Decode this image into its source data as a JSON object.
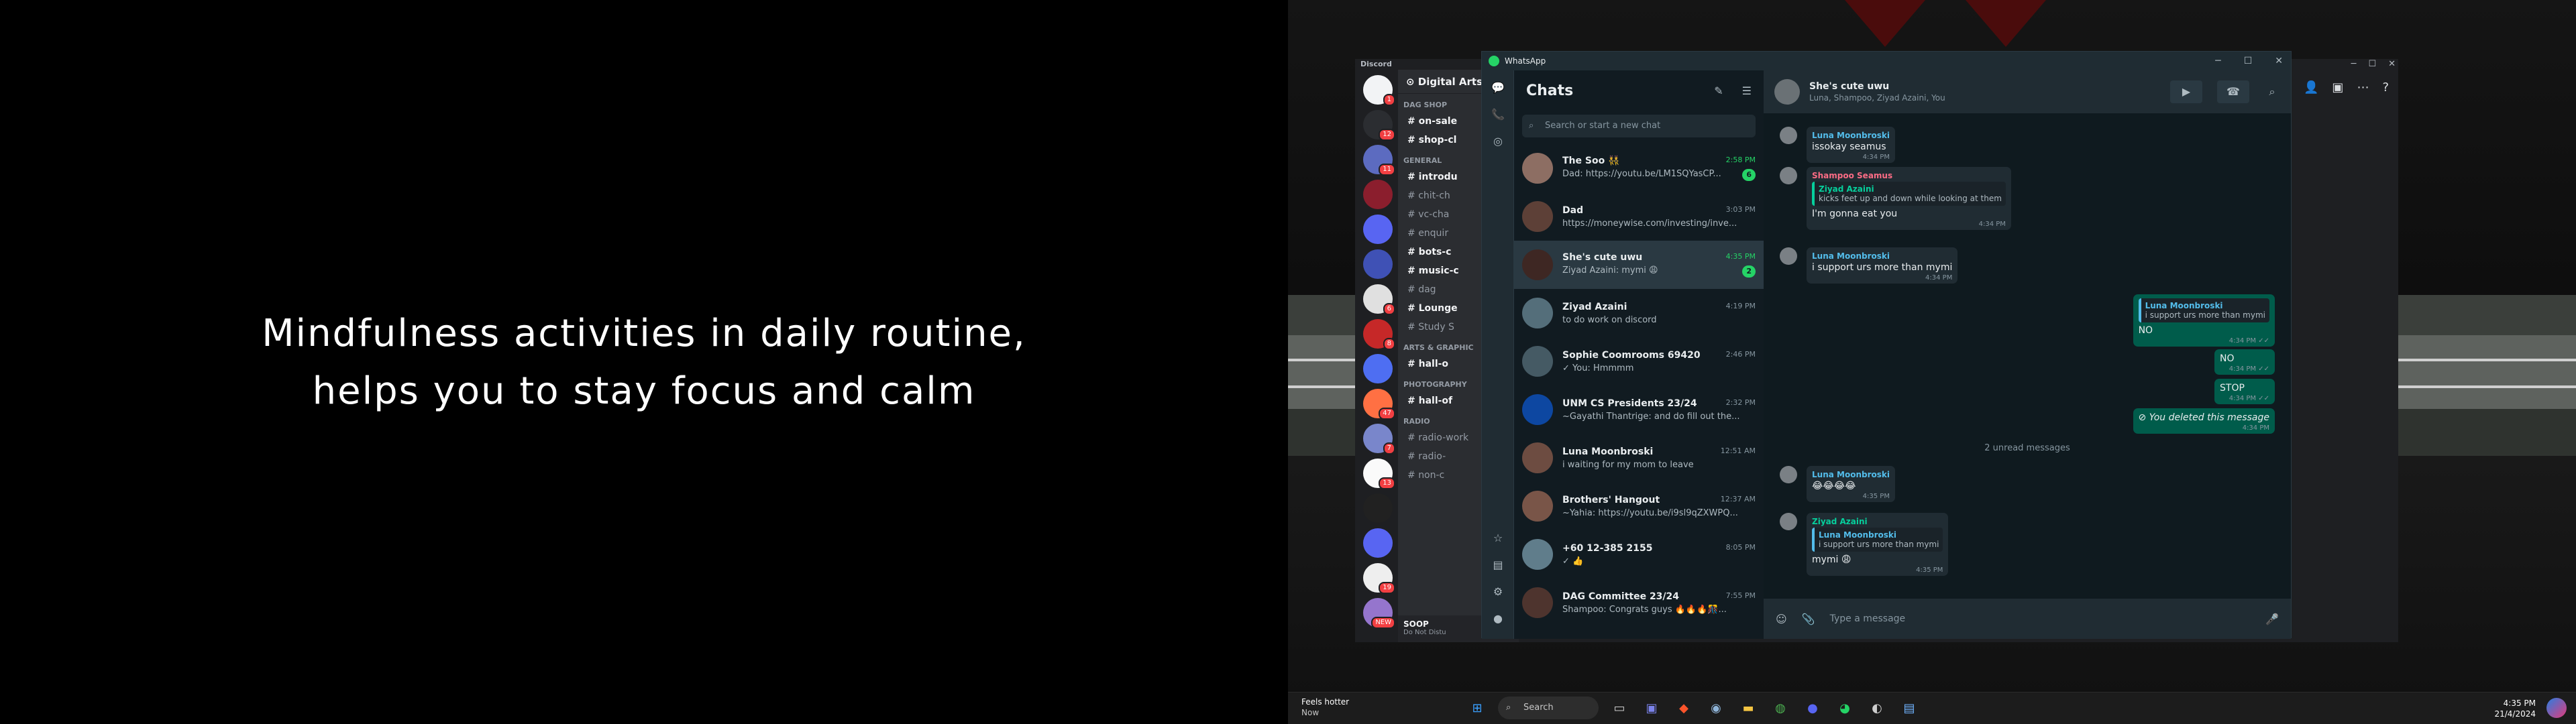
{
  "quote": {
    "line1": "Mindfulness activities in daily routine,",
    "line2": "helps you to stay focus and calm"
  },
  "discord": {
    "app_name": "Discord",
    "guild_name": "Digital Arts",
    "server_badges": [
      "1",
      "12",
      "11",
      "",
      "",
      "",
      "6",
      "8",
      "",
      "47",
      "7",
      "13",
      "",
      "",
      "19",
      "NEW"
    ],
    "categories": [
      {
        "name": "DAG SHOP",
        "channels": [
          {
            "name": "on-sale",
            "unread": true
          },
          {
            "name": "shop-cl",
            "unread": true
          }
        ]
      },
      {
        "name": "GENERAL",
        "channels": [
          {
            "name": "introdu",
            "unread": true
          },
          {
            "name": "chit-ch",
            "unread": false
          },
          {
            "name": "vc-cha",
            "unread": false
          },
          {
            "name": "enquir",
            "unread": false
          },
          {
            "name": "bots-c",
            "unread": true
          },
          {
            "name": "music-c",
            "unread": true
          },
          {
            "name": "dag",
            "unread": false
          },
          {
            "name": "Lounge",
            "unread": true
          },
          {
            "name": "Study S",
            "unread": false
          }
        ]
      },
      {
        "name": "ARTS & GRAPHIC",
        "channels": [
          {
            "name": "hall-o",
            "unread": true
          }
        ]
      },
      {
        "name": "PHOTOGRAPHY",
        "channels": [
          {
            "name": "hall-of",
            "unread": true
          }
        ]
      },
      {
        "name": "RADIO",
        "channels": [
          {
            "name": "radio-work",
            "unread": false
          },
          {
            "name": "radio-",
            "unread": false
          },
          {
            "name": "non-c",
            "unread": false
          }
        ]
      }
    ],
    "user": {
      "name": "SOOP",
      "status": "Do Not Distu"
    }
  },
  "whatsapp": {
    "title": "WhatsApp",
    "chats_title": "Chats",
    "search_placeholder": "Search or start a new chat",
    "chats": [
      {
        "name": "The Soo 👯",
        "time": "2:58 PM",
        "preview": "Dad: https://youtu.be/LM1SQYasCP...",
        "unread": "6",
        "time_green": true
      },
      {
        "name": "Dad",
        "time": "3:03 PM",
        "preview": "https://moneywise.com/investing/inve...",
        "unread": "",
        "time_green": false
      },
      {
        "name": "She's cute uwu",
        "time": "4:35 PM",
        "preview": "Ziyad Azaini: mymi 😩",
        "unread": "2",
        "time_green": true
      },
      {
        "name": "Ziyad Azaini",
        "time": "4:19 PM",
        "preview": "to do work on discord",
        "unread": "",
        "time_green": false
      },
      {
        "name": "Sophie Coomrooms 69420",
        "time": "2:46 PM",
        "preview": "✓ You: Hmmmm",
        "unread": "",
        "time_green": false
      },
      {
        "name": "UNM CS Presidents 23/24",
        "time": "2:32 PM",
        "preview": "~Gayathi Thantrige: and do fill out the...",
        "unread": "",
        "time_green": false
      },
      {
        "name": "Luna Moonbroski",
        "time": "12:51 AM",
        "preview": "i waiting for my mom to leave",
        "unread": "",
        "time_green": false
      },
      {
        "name": "Brothers' Hangout",
        "time": "12:37 AM",
        "preview": "~Yahia: https://youtu.be/i9sl9qZXWPQ...",
        "unread": "",
        "time_green": false
      },
      {
        "name": "+60 12-385 2155",
        "time": "8:05 PM",
        "preview": "✓ 👍",
        "unread": "",
        "time_green": false
      },
      {
        "name": "DAG Committee 23/24",
        "time": "7:55 PM",
        "preview": "Shampoo: Congrats guys 🔥🔥🔥🎊...",
        "unread": "",
        "time_green": false
      }
    ],
    "conversation": {
      "name": "She's cute uwu",
      "members": "Luna, Shampoo, Ziyad Azaini, You",
      "messages": [
        {
          "author": "Luna Moonbroski",
          "text": "issokay seamus",
          "time": "4:34 PM"
        },
        {
          "author": "Shampoo Seamus",
          "quote_author": "Ziyad Azaini",
          "quote_text": "kicks feet up and down while looking at them",
          "text": "I'm gonna eat you",
          "time": "4:34 PM"
        },
        {
          "author": "Luna Moonbroski",
          "text": "i support urs more than mymi",
          "time": "4:34 PM"
        },
        {
          "quote_author": "Luna Moonbroski",
          "quote_text": "i support urs more than mymi",
          "text": "NO",
          "time": "4:34 PM ✓✓"
        },
        {
          "text": "NO",
          "time": "4:34 PM ✓✓"
        },
        {
          "text": "STOP",
          "time": "4:34 PM ✓✓"
        },
        {
          "text": "⊘ You deleted this message",
          "time": "4:34 PM"
        },
        {
          "author": "Luna Moonbroski",
          "text": "😂😂😂😂",
          "time": "4:35 PM"
        },
        {
          "author": "Ziyad Azaini",
          "quote_author": "Luna Moonbroski",
          "quote_text": "i support urs more than mymi",
          "text": "mymi 😩",
          "time": "4:35 PM"
        }
      ],
      "unread_separator": "2 unread messages",
      "composer_placeholder": "Type a message"
    }
  },
  "taskbar": {
    "weather_title": "Feels hotter",
    "weather_sub": "Now",
    "search_label": "Search",
    "time": "4:35 PM",
    "date": "21/4/2024"
  },
  "colors": {
    "wa_green": "#25d366",
    "wa_out": "#005c4b",
    "discord_bg": "#1e1f22"
  }
}
